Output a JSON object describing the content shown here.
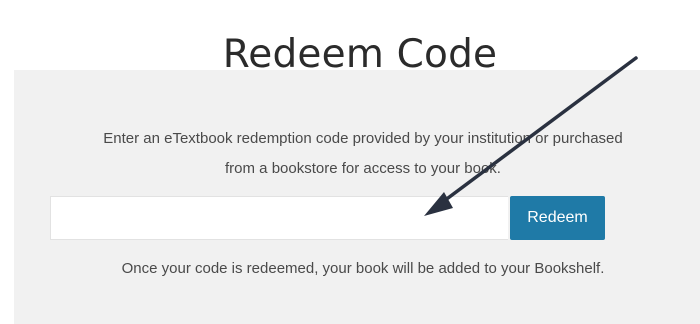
{
  "page": {
    "title": "Redeem Code"
  },
  "redeem_panel": {
    "description_line1": "Enter an eTextbook redemption code provided by your institution or purchased",
    "description_line2": "from a bookstore for access to your book.",
    "code_input_value": "",
    "redeem_button_label": "Redeem",
    "helper_text": "Once your code is redeemed, your book will be added to your Bookshelf."
  },
  "colors": {
    "button_background": "#1f7aa7",
    "panel_background": "#f1f1f1",
    "annotation_arrow": "#2a3140"
  },
  "icons": {
    "annotation": "arrow-pointer-icon"
  }
}
